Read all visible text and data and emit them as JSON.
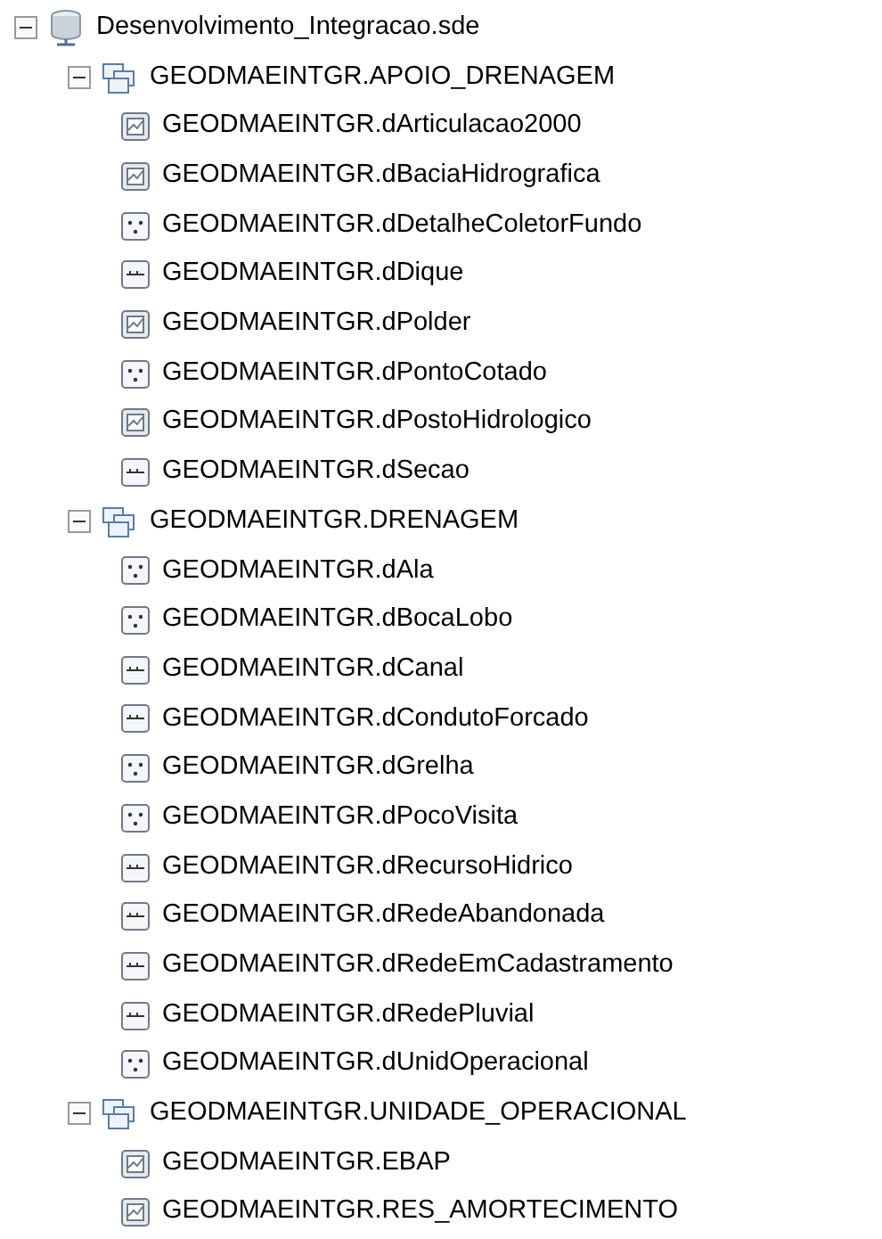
{
  "tree": [
    {
      "kind": "database",
      "label": "Desenvolvimento_Integracao.sde",
      "expanded": true,
      "children": [
        {
          "kind": "dataset",
          "label": "GEODMAEINTGR.APOIO_DRENAGEM",
          "expanded": true,
          "children": [
            {
              "kind": "polygon",
              "label": "GEODMAEINTGR.dArticulacao2000"
            },
            {
              "kind": "polygon",
              "label": "GEODMAEINTGR.dBaciaHidrografica"
            },
            {
              "kind": "point",
              "label": "GEODMAEINTGR.dDetalheColetorFundo"
            },
            {
              "kind": "line",
              "label": "GEODMAEINTGR.dDique"
            },
            {
              "kind": "polygon",
              "label": "GEODMAEINTGR.dPolder"
            },
            {
              "kind": "point",
              "label": "GEODMAEINTGR.dPontoCotado"
            },
            {
              "kind": "polygon",
              "label": "GEODMAEINTGR.dPostoHidrologico"
            },
            {
              "kind": "line",
              "label": "GEODMAEINTGR.dSecao"
            }
          ]
        },
        {
          "kind": "dataset",
          "label": "GEODMAEINTGR.DRENAGEM",
          "expanded": true,
          "children": [
            {
              "kind": "point",
              "label": "GEODMAEINTGR.dAla"
            },
            {
              "kind": "point",
              "label": "GEODMAEINTGR.dBocaLobo"
            },
            {
              "kind": "line",
              "label": "GEODMAEINTGR.dCanal"
            },
            {
              "kind": "line",
              "label": "GEODMAEINTGR.dCondutoForcado"
            },
            {
              "kind": "point",
              "label": "GEODMAEINTGR.dGrelha"
            },
            {
              "kind": "point",
              "label": "GEODMAEINTGR.dPocoVisita"
            },
            {
              "kind": "line",
              "label": "GEODMAEINTGR.dRecursoHidrico"
            },
            {
              "kind": "line",
              "label": "GEODMAEINTGR.dRedeAbandonada"
            },
            {
              "kind": "line",
              "label": "GEODMAEINTGR.dRedeEmCadastramento"
            },
            {
              "kind": "line",
              "label": "GEODMAEINTGR.dRedePluvial"
            },
            {
              "kind": "point",
              "label": "GEODMAEINTGR.dUnidOperacional"
            }
          ]
        },
        {
          "kind": "dataset",
          "label": "GEODMAEINTGR.UNIDADE_OPERACIONAL",
          "expanded": true,
          "children": [
            {
              "kind": "polygon",
              "label": "GEODMAEINTGR.EBAP"
            },
            {
              "kind": "polygon",
              "label": "GEODMAEINTGR.RES_AMORTECIMENTO"
            }
          ]
        }
      ]
    }
  ]
}
